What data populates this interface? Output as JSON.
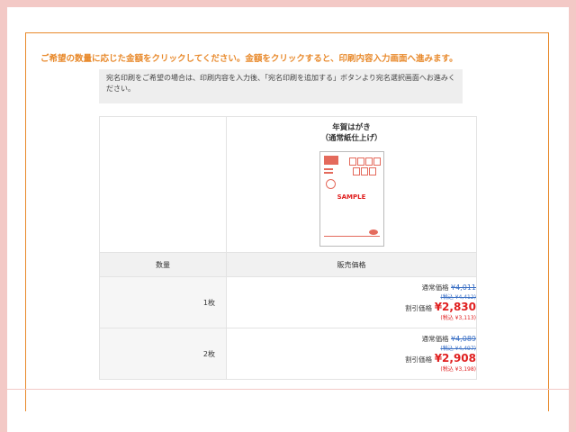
{
  "headline": "ご希望の数量に応じた金額をクリックしてください。金額をクリックすると、印刷内容入力画面へ進みます。",
  "note": "宛名印刷をご希望の場合は、印刷内容を入力後、「宛名印刷を追加する」ボタンより宛名選択画面へお進みください。",
  "product": {
    "title": "年賀はがき",
    "subtitle": "（通常紙仕上げ）",
    "sample_label": "SAMPLE"
  },
  "table": {
    "headers": [
      "数量",
      "販売価格"
    ],
    "rows": [
      {
        "qty": "1枚",
        "normal_label": "通常価格",
        "normal_price": "¥4,011",
        "normal_taxin": "(税込 ¥4,412)",
        "disc_label": "割引価格",
        "disc_price": "¥2,830",
        "disc_taxin": "(税込 ¥3,113)"
      },
      {
        "qty": "2枚",
        "normal_label": "通常価格",
        "normal_price": "¥4,089",
        "normal_taxin": "(税込 ¥4,497)",
        "disc_label": "割引価格",
        "disc_price": "¥2,908",
        "disc_taxin": "(税込 ¥3,198)"
      }
    ]
  },
  "colors": {
    "accent": "#e8892b",
    "discount": "#e02020",
    "strike": "#3a6fc4",
    "background": "#f3c9c6"
  }
}
